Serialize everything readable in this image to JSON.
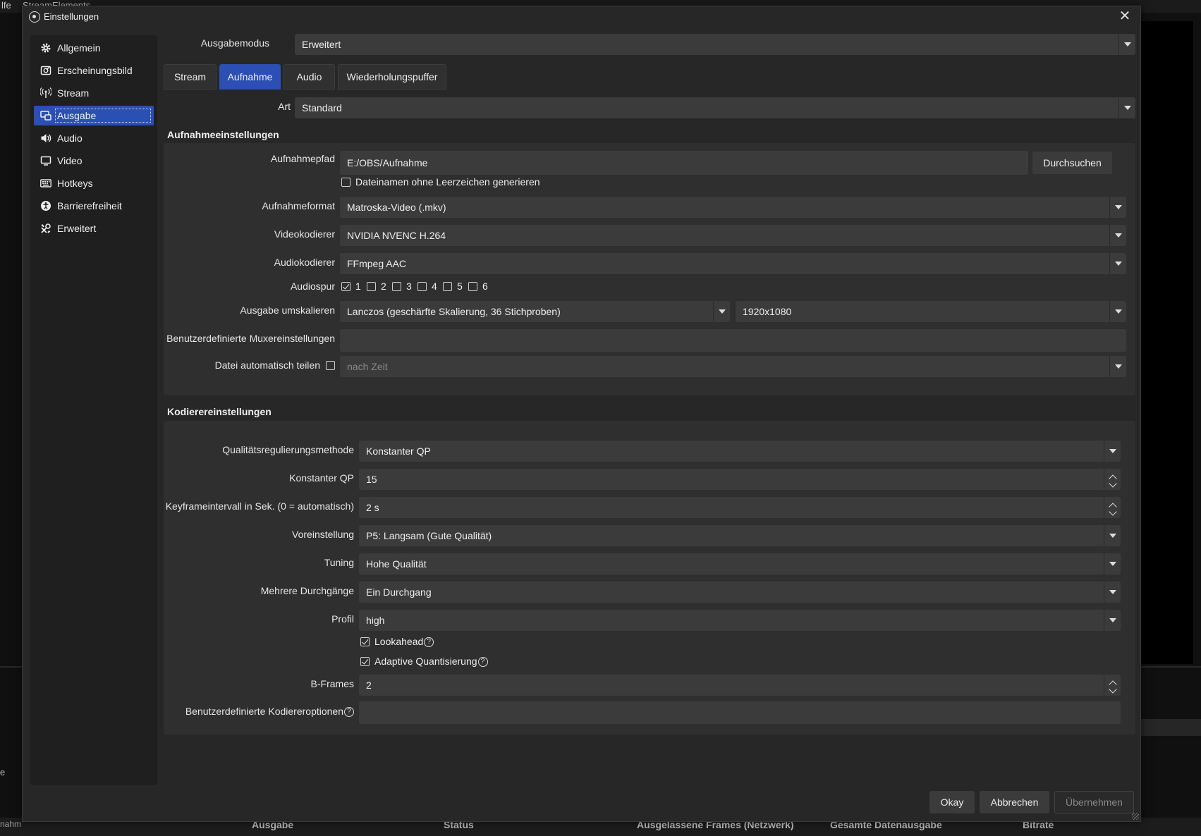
{
  "background": {
    "menu": [
      "lfe",
      "StreamElements"
    ],
    "status_columns": [
      "Ausgabe",
      "Status",
      "Ausgelassene Frames (Netzwerk)",
      "Gesamte Datenausgabe",
      "Bitrate"
    ],
    "left_fragment_1": "e",
    "left_fragment_2": "nahm"
  },
  "window": {
    "title": "Einstellungen",
    "close_glyph": "✕"
  },
  "sidebar": {
    "items": [
      {
        "label": "Allgemein",
        "icon": "gear-icon"
      },
      {
        "label": "Erscheinungsbild",
        "icon": "appearance-icon"
      },
      {
        "label": "Stream",
        "icon": "antenna-icon"
      },
      {
        "label": "Ausgabe",
        "icon": "output-icon",
        "active": true
      },
      {
        "label": "Audio",
        "icon": "speaker-icon"
      },
      {
        "label": "Video",
        "icon": "monitor-icon"
      },
      {
        "label": "Hotkeys",
        "icon": "keyboard-icon"
      },
      {
        "label": "Barrierefreiheit",
        "icon": "accessibility-icon"
      },
      {
        "label": "Erweitert",
        "icon": "tools-icon"
      }
    ]
  },
  "output": {
    "mode_label": "Ausgabemodus",
    "mode_value": "Erweitert",
    "tabs": [
      "Stream",
      "Aufnahme",
      "Audio",
      "Wiederholungspuffer"
    ],
    "active_tab": "Aufnahme",
    "type_label": "Art",
    "type_value": "Standard"
  },
  "recording": {
    "title": "Aufnahmeeinstellungen",
    "path_label": "Aufnahmepfad",
    "path_value": "E:/OBS/Aufnahme",
    "browse_label": "Durchsuchen",
    "no_space_label": "Dateinamen ohne Leerzeichen generieren",
    "no_space_checked": false,
    "format_label": "Aufnahmeformat",
    "format_value": "Matroska-Video (.mkv)",
    "video_encoder_label": "Videokodierer",
    "video_encoder_value": "NVIDIA NVENC H.264",
    "audio_encoder_label": "Audiokodierer",
    "audio_encoder_value": "FFmpeg AAC",
    "audio_track_label": "Audiospur",
    "audio_tracks": [
      {
        "label": "1",
        "checked": true
      },
      {
        "label": "2",
        "checked": false
      },
      {
        "label": "3",
        "checked": false
      },
      {
        "label": "4",
        "checked": false
      },
      {
        "label": "5",
        "checked": false
      },
      {
        "label": "6",
        "checked": false
      }
    ],
    "rescale_label": "Ausgabe umskalieren",
    "rescale_filter": "Lanczos (geschärfte Skalierung, 36 Stichproben)",
    "rescale_resolution": "1920x1080",
    "muxer_label": "Benutzerdefinierte Muxereinstellungen",
    "muxer_value": "",
    "autosplit_label": "Datei automatisch teilen",
    "autosplit_checked": false,
    "autosplit_value": "nach Zeit"
  },
  "encoder": {
    "title": "Kodierereinstellungen",
    "rate_control_label": "Qualitätsregulierungsmethode",
    "rate_control_value": "Konstanter QP",
    "cqp_label": "Konstanter QP",
    "cqp_value": "15",
    "keyframe_label": "Keyframeintervall in Sek. (0 = automatisch)",
    "keyframe_value": "2 s",
    "preset_label": "Voreinstellung",
    "preset_value": "P5: Langsam (Gute Qualität)",
    "tuning_label": "Tuning",
    "tuning_value": "Hohe Qualität",
    "multipass_label": "Mehrere Durchgänge",
    "multipass_value": "Ein Durchgang",
    "profile_label": "Profil",
    "profile_value": "high",
    "lookahead_label": "Lookahead",
    "lookahead_checked": true,
    "aq_label": "Adaptive Quantisierung",
    "aq_checked": true,
    "bframes_label": "B-Frames",
    "bframes_value": "2",
    "custom_opts_label": "Benutzerdefinierte Kodiereroptionen",
    "custom_opts_value": "",
    "help_glyph": "?"
  },
  "footer": {
    "ok_label": "Okay",
    "cancel_label": "Abbrechen",
    "apply_label": "Übernehmen"
  }
}
